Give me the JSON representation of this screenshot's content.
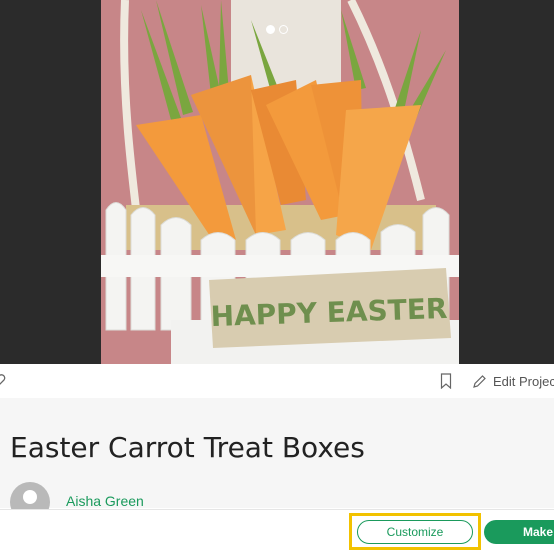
{
  "carousel": {
    "slide_count": 2,
    "active_index": 0
  },
  "photo": {
    "sign_text": "HAPPY EASTER",
    "colors": {
      "carrot": "#f39a3c",
      "carrot_shade": "#d9782a",
      "leaves": "#7aa63f",
      "fence": "#f4f4f2",
      "sign": "#d8ccb0",
      "sign_text": "#6f8f4e"
    }
  },
  "actions": {
    "favorite_icon": "heart-icon",
    "bookmark_icon": "bookmark-icon",
    "edit_icon": "pencil-icon",
    "edit_label": "Edit Project"
  },
  "project": {
    "title": "Easter Carrot Treat Boxes",
    "author": "Aisha Green"
  },
  "footer": {
    "customize_label": "Customize",
    "make_label": "Make"
  },
  "colors": {
    "accent": "#1a9a5c",
    "highlight": "#f2c200",
    "title": "#222222"
  }
}
